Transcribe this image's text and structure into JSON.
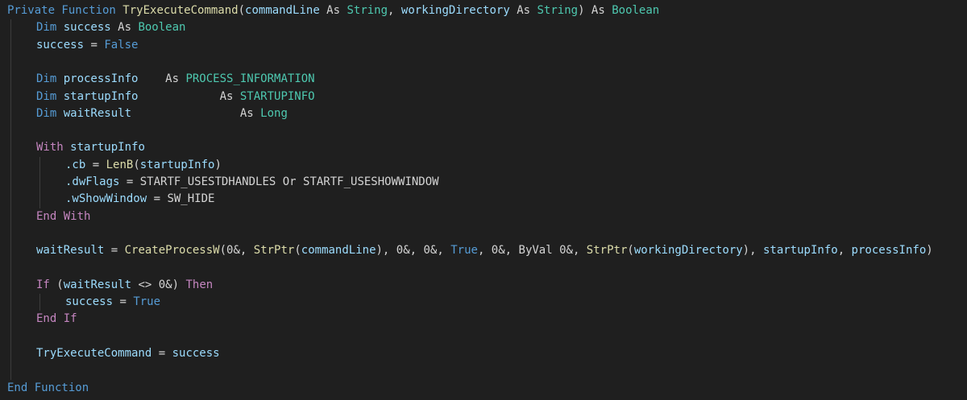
{
  "editor": {
    "language": "VBA",
    "colors": {
      "background": "#1f1f1f",
      "keyword": "#569cd6",
      "control": "#c586c0",
      "function": "#dcdcaa",
      "type": "#4ec9b0",
      "variable": "#9cdcfe",
      "plain": "#d4d4d4",
      "indent_guide": "#3c3c3c"
    },
    "lines": [
      {
        "indent": 0,
        "tokens": [
          {
            "t": "kw",
            "v": "Private Function "
          },
          {
            "t": "fn",
            "v": "TryExecuteCommand"
          },
          {
            "t": "plain",
            "v": "("
          },
          {
            "t": "var",
            "v": "commandLine"
          },
          {
            "t": "plain",
            "v": " As "
          },
          {
            "t": "type",
            "v": "String"
          },
          {
            "t": "plain",
            "v": ", "
          },
          {
            "t": "var",
            "v": "workingDirectory"
          },
          {
            "t": "plain",
            "v": " As "
          },
          {
            "t": "type",
            "v": "String"
          },
          {
            "t": "plain",
            "v": ") As "
          },
          {
            "t": "type",
            "v": "Boolean"
          }
        ]
      },
      {
        "indent": 1,
        "tokens": [
          {
            "t": "kw",
            "v": "Dim "
          },
          {
            "t": "var",
            "v": "success"
          },
          {
            "t": "plain",
            "v": " As "
          },
          {
            "t": "type",
            "v": "Boolean"
          }
        ]
      },
      {
        "indent": 1,
        "tokens": [
          {
            "t": "var",
            "v": "success"
          },
          {
            "t": "plain",
            "v": " = "
          },
          {
            "t": "kw",
            "v": "False"
          }
        ]
      },
      {
        "indent": 0,
        "tokens": []
      },
      {
        "indent": 1,
        "tokens": [
          {
            "t": "kw",
            "v": "Dim "
          },
          {
            "t": "var",
            "v": "processInfo"
          },
          {
            "t": "plain",
            "v": "    As "
          },
          {
            "t": "type",
            "v": "PROCESS_INFORMATION"
          }
        ]
      },
      {
        "indent": 1,
        "tokens": [
          {
            "t": "kw",
            "v": "Dim "
          },
          {
            "t": "var",
            "v": "startupInfo"
          },
          {
            "t": "plain",
            "v": "            As "
          },
          {
            "t": "type",
            "v": "STARTUPINFO"
          }
        ]
      },
      {
        "indent": 1,
        "tokens": [
          {
            "t": "kw",
            "v": "Dim "
          },
          {
            "t": "var",
            "v": "waitResult"
          },
          {
            "t": "plain",
            "v": "                As "
          },
          {
            "t": "type",
            "v": "Long"
          }
        ]
      },
      {
        "indent": 0,
        "tokens": []
      },
      {
        "indent": 1,
        "tokens": [
          {
            "t": "ctrl",
            "v": "With "
          },
          {
            "t": "var",
            "v": "startupInfo"
          }
        ]
      },
      {
        "indent": 2,
        "tokens": [
          {
            "t": "var",
            "v": ".cb"
          },
          {
            "t": "plain",
            "v": " = "
          },
          {
            "t": "fn",
            "v": "LenB"
          },
          {
            "t": "plain",
            "v": "("
          },
          {
            "t": "var",
            "v": "startupInfo"
          },
          {
            "t": "plain",
            "v": ")"
          }
        ]
      },
      {
        "indent": 2,
        "tokens": [
          {
            "t": "var",
            "v": ".dwFlags"
          },
          {
            "t": "plain",
            "v": " = STARTF_USESTDHANDLES Or STARTF_USESHOWWINDOW"
          }
        ]
      },
      {
        "indent": 2,
        "tokens": [
          {
            "t": "var",
            "v": ".wShowWindow"
          },
          {
            "t": "plain",
            "v": " = SW_HIDE"
          }
        ]
      },
      {
        "indent": 1,
        "tokens": [
          {
            "t": "ctrl",
            "v": "End With"
          }
        ]
      },
      {
        "indent": 0,
        "tokens": []
      },
      {
        "indent": 1,
        "tokens": [
          {
            "t": "var",
            "v": "waitResult"
          },
          {
            "t": "plain",
            "v": " = "
          },
          {
            "t": "fn",
            "v": "CreateProcessW"
          },
          {
            "t": "plain",
            "v": "(0&, "
          },
          {
            "t": "fn",
            "v": "StrPtr"
          },
          {
            "t": "plain",
            "v": "("
          },
          {
            "t": "var",
            "v": "commandLine"
          },
          {
            "t": "plain",
            "v": "), 0&, 0&, "
          },
          {
            "t": "kw",
            "v": "True"
          },
          {
            "t": "plain",
            "v": ", 0&, ByVal 0&, "
          },
          {
            "t": "fn",
            "v": "StrPtr"
          },
          {
            "t": "plain",
            "v": "("
          },
          {
            "t": "var",
            "v": "workingDirectory"
          },
          {
            "t": "plain",
            "v": "), "
          },
          {
            "t": "var",
            "v": "startupInfo"
          },
          {
            "t": "plain",
            "v": ", "
          },
          {
            "t": "var",
            "v": "processInfo"
          },
          {
            "t": "plain",
            "v": ")"
          }
        ]
      },
      {
        "indent": 0,
        "tokens": []
      },
      {
        "indent": 1,
        "tokens": [
          {
            "t": "ctrl",
            "v": "If "
          },
          {
            "t": "plain",
            "v": "("
          },
          {
            "t": "var",
            "v": "waitResult"
          },
          {
            "t": "plain",
            "v": " <> 0&) "
          },
          {
            "t": "ctrl",
            "v": "Then"
          }
        ]
      },
      {
        "indent": 2,
        "tokens": [
          {
            "t": "var",
            "v": "success"
          },
          {
            "t": "plain",
            "v": " = "
          },
          {
            "t": "kw",
            "v": "True"
          }
        ]
      },
      {
        "indent": 1,
        "tokens": [
          {
            "t": "ctrl",
            "v": "End If"
          }
        ]
      },
      {
        "indent": 0,
        "tokens": []
      },
      {
        "indent": 1,
        "tokens": [
          {
            "t": "var",
            "v": "TryExecuteCommand"
          },
          {
            "t": "plain",
            "v": " = "
          },
          {
            "t": "var",
            "v": "success"
          }
        ]
      },
      {
        "indent": 0,
        "tokens": []
      },
      {
        "indent": 0,
        "tokens": [
          {
            "t": "kw",
            "v": "End Function"
          }
        ]
      }
    ]
  }
}
